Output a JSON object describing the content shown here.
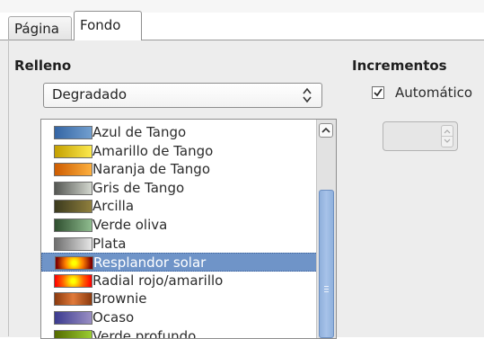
{
  "tabs": [
    {
      "label": "Página",
      "active": false
    },
    {
      "label": "Fondo",
      "active": true
    }
  ],
  "fill": {
    "heading": "Relleno",
    "type_value": "Degradado",
    "gradients": [
      {
        "name": "Azul de Tango",
        "swatch": "linear-gradient(90deg,#3465a4,#729fcf)",
        "selected": false
      },
      {
        "name": "Amarillo de Tango",
        "swatch": "linear-gradient(90deg,#c4a000,#fce94f)",
        "selected": false
      },
      {
        "name": "Naranja de Tango",
        "swatch": "linear-gradient(90deg,#ce5c00,#fcaf3e)",
        "selected": false
      },
      {
        "name": "Gris de Tango",
        "swatch": "linear-gradient(90deg,#555753,#d3d7cf)",
        "selected": false
      },
      {
        "name": "Arcilla",
        "swatch": "linear-gradient(90deg,#3b3a1e,#8f7f3d)",
        "selected": false
      },
      {
        "name": "Verde oliva",
        "swatch": "linear-gradient(90deg,#2f4f2f,#8fbc8f)",
        "selected": false
      },
      {
        "name": "Plata",
        "swatch": "linear-gradient(90deg,#6e6e6e,#e6e6e6)",
        "selected": false
      },
      {
        "name": "Resplandor solar",
        "swatch": "radial-gradient(circle,#ffff00 10%,#ff8000 45%,#800000 90%)",
        "selected": true
      },
      {
        "name": "Radial rojo/amarillo",
        "swatch": "radial-gradient(circle,#ffff00 10%,#ff6000 55%,#ff0000 95%)",
        "selected": false
      },
      {
        "name": "Brownie",
        "swatch": "linear-gradient(90deg,#8b3a0e,#e07a3a,#8b3a0e)",
        "selected": false
      },
      {
        "name": "Ocaso",
        "swatch": "linear-gradient(90deg,#3b3b8f,#9a8fc4)",
        "selected": false
      },
      {
        "name": "Verde profundo",
        "swatch": "linear-gradient(90deg,#556b00,#9acd32)",
        "selected": false
      }
    ]
  },
  "increments": {
    "heading": "Incrementos",
    "automatic_label": "Automático",
    "automatic_checked": true,
    "spin_value": ""
  }
}
